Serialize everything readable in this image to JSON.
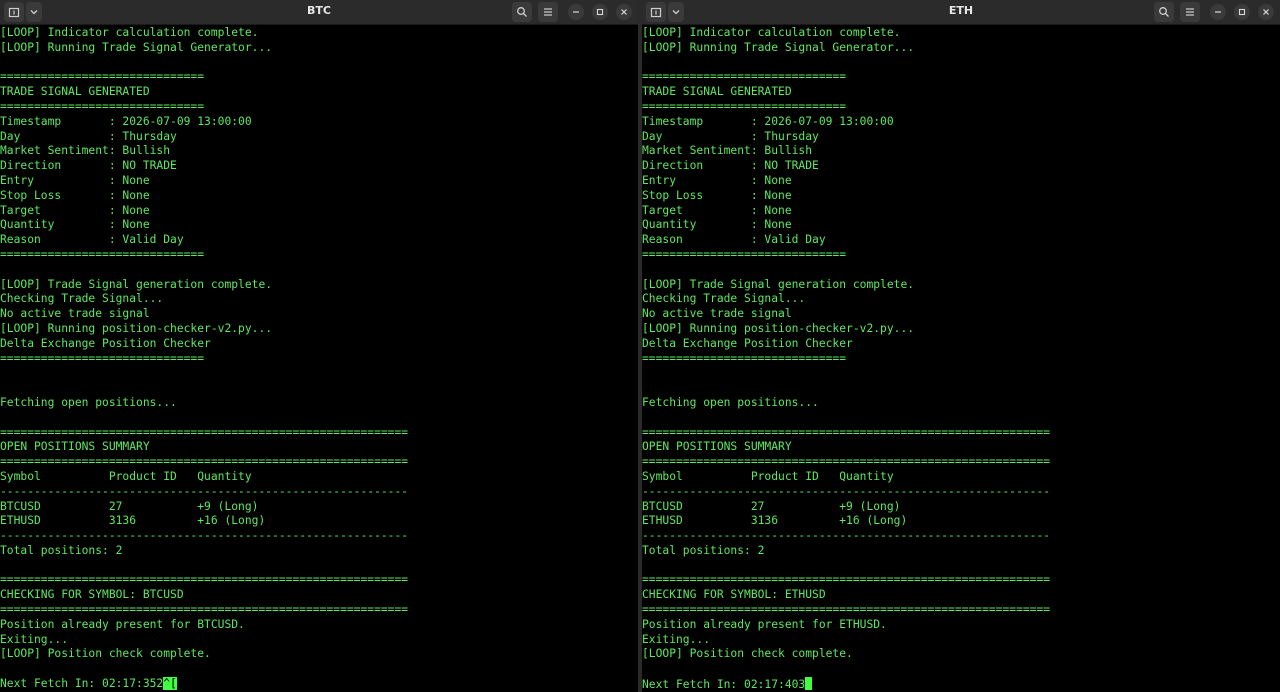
{
  "left": {
    "title": "BTC",
    "lines": [
      "[LOOP] Indicator calculation complete.",
      "[LOOP] Running Trade Signal Generator...",
      "",
      "==============================",
      "TRADE SIGNAL GENERATED",
      "==============================",
      "Timestamp       : 2026-07-09 13:00:00",
      "Day             : Thursday",
      "Market Sentiment: Bullish",
      "Direction       : NO TRADE",
      "Entry           : None",
      "Stop Loss       : None",
      "Target          : None",
      "Quantity        : None",
      "Reason          : Valid Day",
      "==============================",
      "",
      "[LOOP] Trade Signal generation complete.",
      "Checking Trade Signal...",
      "No active trade signal",
      "[LOOP] Running position-checker-v2.py...",
      "Delta Exchange Position Checker",
      "==============================",
      "",
      "",
      "Fetching open positions...",
      "",
      "============================================================",
      "OPEN POSITIONS SUMMARY",
      "============================================================",
      "Symbol          Product ID   Quantity",
      "------------------------------------------------------------",
      "BTCUSD          27           +9 (Long)",
      "ETHUSD          3136         +16 (Long)",
      "------------------------------------------------------------",
      "Total positions: 2",
      "",
      "============================================================",
      "CHECKING FOR SYMBOL: BTCUSD",
      "============================================================",
      "Position already present for BTCUSD.",
      "Exiting...",
      "[LOOP] Position check complete.",
      ""
    ],
    "prompt": "Next Fetch In: 02:17:352",
    "trailing_chars": "^[",
    "trailing_after": ""
  },
  "right": {
    "title": "ETH",
    "lines": [
      "[LOOP] Indicator calculation complete.",
      "[LOOP] Running Trade Signal Generator...",
      "",
      "==============================",
      "TRADE SIGNAL GENERATED",
      "==============================",
      "Timestamp       : 2026-07-09 13:00:00",
      "Day             : Thursday",
      "Market Sentiment: Bullish",
      "Direction       : NO TRADE",
      "Entry           : None",
      "Stop Loss       : None",
      "Target          : None",
      "Quantity        : None",
      "Reason          : Valid Day",
      "==============================",
      "",
      "[LOOP] Trade Signal generation complete.",
      "Checking Trade Signal...",
      "No active trade signal",
      "[LOOP] Running position-checker-v2.py...",
      "Delta Exchange Position Checker",
      "==============================",
      "",
      "",
      "Fetching open positions...",
      "",
      "============================================================",
      "OPEN POSITIONS SUMMARY",
      "============================================================",
      "Symbol          Product ID   Quantity",
      "------------------------------------------------------------",
      "BTCUSD          27           +9 (Long)",
      "ETHUSD          3136         +16 (Long)",
      "------------------------------------------------------------",
      "Total positions: 2",
      "",
      "============================================================",
      "CHECKING FOR SYMBOL: ETHUSD",
      "============================================================",
      "Position already present for ETHUSD.",
      "Exiting...",
      "[LOOP] Position check complete.",
      ""
    ],
    "prompt": "Next Fetch In: 02:17:403",
    "trailing_chars": "",
    "trailing_after": ""
  },
  "icons": {
    "new_tab": "new-tab-icon",
    "dropdown": "chevron-down-icon",
    "search": "search-icon",
    "menu": "hamburger-menu-icon",
    "minimize": "minimize-icon",
    "maximize": "maximize-icon",
    "close": "close-icon"
  },
  "colors": {
    "terminal_bg": "#000000",
    "terminal_text": "#5ee85e",
    "cursor": "#3fff3f",
    "titlebar": "#2b2b2b"
  }
}
